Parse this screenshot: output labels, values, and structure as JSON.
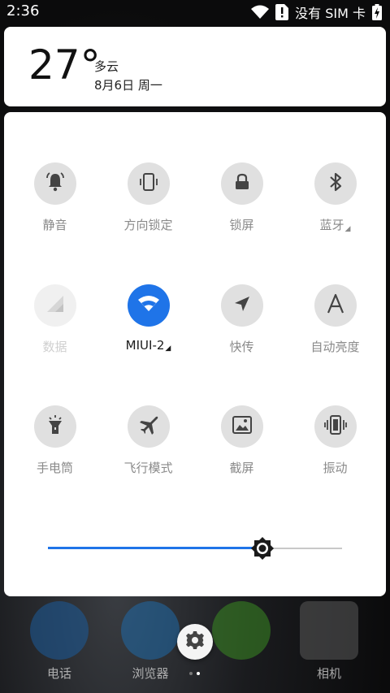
{
  "status_bar": {
    "time": "2:36",
    "carrier": "没有 SIM 卡",
    "icons": [
      "wifi-icon",
      "sim-alert-icon",
      "battery-charging-icon"
    ]
  },
  "weather": {
    "temperature": "27°",
    "condition": "多云",
    "date": "8月6日 周一"
  },
  "quick_settings": {
    "tiles": [
      {
        "label": "静音",
        "icon": "bell-icon",
        "state": "off"
      },
      {
        "label": "方向锁定",
        "icon": "rotation-lock-icon",
        "state": "off"
      },
      {
        "label": "锁屏",
        "icon": "lock-icon",
        "state": "off"
      },
      {
        "label": "蓝牙",
        "icon": "bluetooth-icon",
        "state": "off",
        "has_more": true
      },
      {
        "label": "数据",
        "icon": "mobile-data-icon",
        "state": "disabled"
      },
      {
        "label": "MIUI-2",
        "icon": "wifi-icon",
        "state": "on",
        "has_more": true
      },
      {
        "label": "快传",
        "icon": "navigation-arrow-icon",
        "state": "off"
      },
      {
        "label": "自动亮度",
        "icon": "auto-brightness-icon",
        "state": "off"
      },
      {
        "label": "手电筒",
        "icon": "flashlight-icon",
        "state": "off"
      },
      {
        "label": "飞行模式",
        "icon": "airplane-icon",
        "state": "off"
      },
      {
        "label": "截屏",
        "icon": "screenshot-icon",
        "state": "off"
      },
      {
        "label": "振动",
        "icon": "vibrate-icon",
        "state": "off"
      }
    ],
    "brightness": 0.73
  },
  "dock": {
    "apps": [
      {
        "label": "电话",
        "icon": "phone-icon"
      },
      {
        "label": "浏览器",
        "icon": "browser-icon"
      },
      {
        "label": "",
        "icon": "messages-icon"
      },
      {
        "label": "相机",
        "icon": "camera-icon"
      }
    ],
    "settings_icon": "gear-icon",
    "page_indicator": {
      "count": 2,
      "active": 1
    }
  },
  "colors": {
    "accent": "#1f74e8",
    "tile_off": "#e0e0e0",
    "label_text": "#8a8a8a"
  }
}
